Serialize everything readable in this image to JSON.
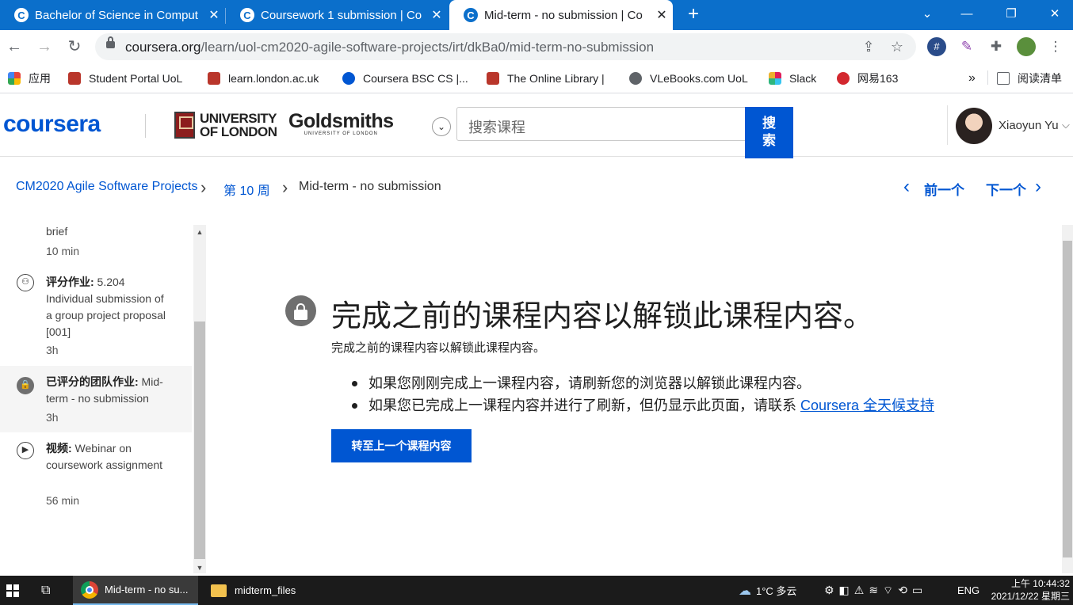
{
  "browser": {
    "tabs": [
      {
        "title": "Bachelor of Science in Comput",
        "favicon": "C",
        "active": false
      },
      {
        "title": "Coursework 1 submission | Co",
        "favicon": "C",
        "active": false
      },
      {
        "title": "Mid-term - no submission | Co",
        "favicon": "C",
        "active": true
      }
    ],
    "url_domain": "coursera.org",
    "url_path": "/learn/uol-cm2020-agile-software-projects/irt/dkBa0/mid-term-no-submission",
    "bookmarks": [
      {
        "label": "应用",
        "color": "#e8453c"
      },
      {
        "label": "Student Portal UoL",
        "color": "#b9362b"
      },
      {
        "label": "learn.london.ac.uk",
        "color": "#b9362b"
      },
      {
        "label": "Coursera BSC CS |...",
        "color": "#0056d2"
      },
      {
        "label": "The Online Library |",
        "color": "#b9362b"
      },
      {
        "label": "VLeBooks.com UoL",
        "color": "#5f6368"
      },
      {
        "label": "Slack",
        "color": "#e01e5a"
      },
      {
        "label": "网易163",
        "color": "#d3282f"
      }
    ],
    "bookmarks_more": "»",
    "reading_list": "阅读清单"
  },
  "header": {
    "logo": "coursera",
    "uol_line1": "UNIVERSITY",
    "uol_line2": "OF LONDON",
    "goldsmiths": "Goldsmiths",
    "goldsmiths_sub": "UNIVERSITY OF LONDON",
    "search_placeholder": "搜索课程",
    "search_button_line1": "搜",
    "search_button_line2": "索",
    "user_name": "Xiaoyun Yu"
  },
  "breadcrumb": {
    "course": "CM2020 Agile Software Projects",
    "week": "第 10 周",
    "current": "Mid-term - no submission",
    "prev": "前一个",
    "next": "下一个"
  },
  "sidebar": {
    "items": [
      {
        "title": "brief",
        "duration": "10 min"
      },
      {
        "type": "评分作业:",
        "title": " 5.204 Individual submission of a group project proposal [001]",
        "duration": "3h",
        "icon": "graded-assignment-icon"
      },
      {
        "type": "已评分的团队作业:",
        "title": " Mid-term - no submission",
        "duration": "3h",
        "icon": "lock-icon",
        "selected": true
      },
      {
        "type": "视频:",
        "title": " Webinar on coursework assignment",
        "duration": "56 min",
        "icon": "play-icon"
      }
    ]
  },
  "main": {
    "title": "完成之前的课程内容以解锁此课程内容。",
    "subtitle": "完成之前的课程内容以解锁此课程内容。",
    "bullet1": "如果您刚刚完成上一课程内容，请刷新您的浏览器以解锁此课程内容。",
    "bullet2_prefix": "如果您已完成上一课程内容并进行了刷新，但仍显示此页面，请联系 ",
    "bullet2_link": "Coursera 全天候支持",
    "button": "转至上一个课程内容"
  },
  "taskbar": {
    "chrome_app": "Mid-term - no su...",
    "folder_app": "midterm_files",
    "weather": "1°C 多云",
    "lang": "ENG",
    "time": "上午 10:44:32",
    "date": "2021/12/22 星期三"
  },
  "colors": {
    "accent": "#0056d2",
    "tabbar": "#0b6fcb"
  }
}
